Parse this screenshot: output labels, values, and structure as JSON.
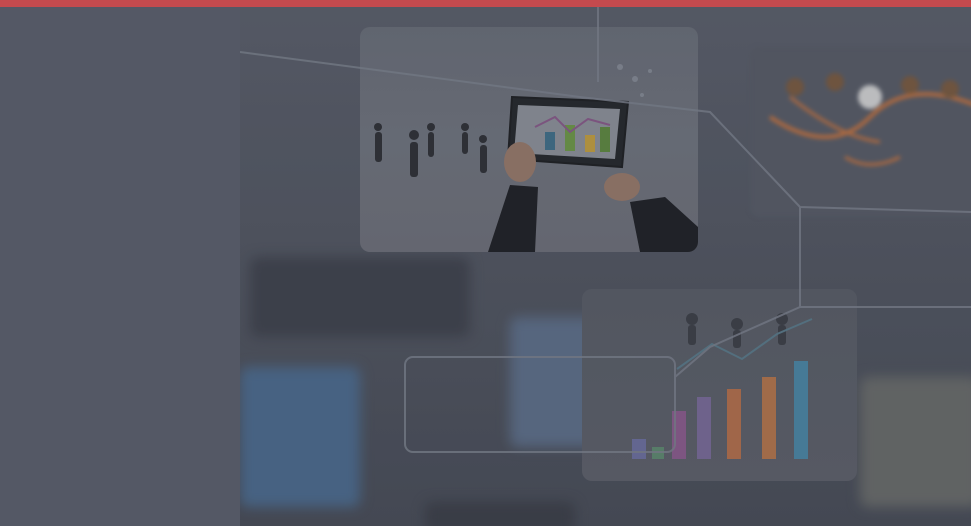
{
  "colors": {
    "accent_bar": "#c44a4e",
    "sidebar_bg": "#545865",
    "hero_overlay": "#4f5360"
  },
  "hero": {
    "images": [
      {
        "subject": "business-people-tablet-chart"
      },
      {
        "subject": "bar-chart-growth"
      },
      {
        "subject": "network-people-diagram"
      }
    ]
  }
}
